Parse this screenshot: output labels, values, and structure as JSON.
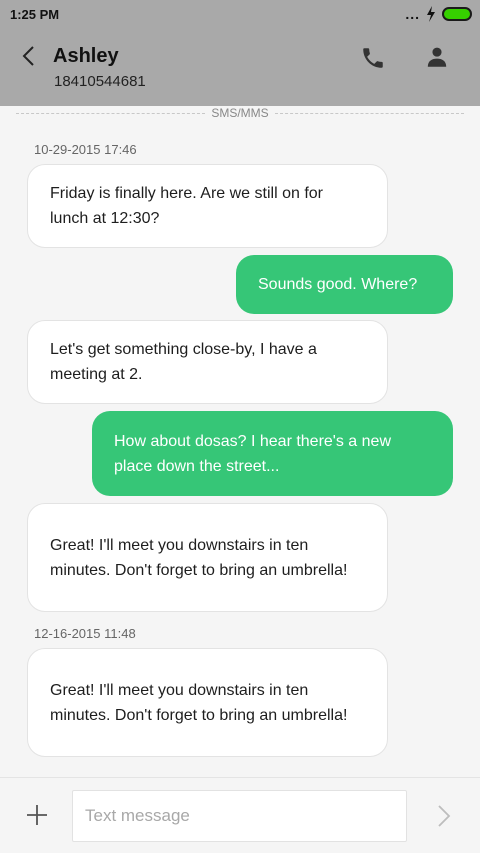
{
  "status_bar": {
    "time": "1:25 PM",
    "signal": "..."
  },
  "header": {
    "contact_name": "Ashley",
    "contact_number": "18410544681"
  },
  "channel_label": "SMS/MMS",
  "messages": [
    {
      "timestamp": "10-29-2015 17:46"
    },
    {
      "direction": "in",
      "text": "Friday is finally here. Are we still on for lunch at 12:30?"
    },
    {
      "direction": "out",
      "text": "Sounds good. Where?"
    },
    {
      "direction": "in",
      "text": "Let's get something close-by, I have a meeting at 2."
    },
    {
      "direction": "out",
      "text": "How about dosas? I hear there's a new place down the street..."
    },
    {
      "direction": "in",
      "text": "Great! I'll meet you downstairs in ten minutes. Don't forget to bring an umbrella!"
    },
    {
      "timestamp": "12-16-2015 11:48"
    },
    {
      "direction": "in",
      "text": "Great! I'll meet you downstairs in ten minutes. Don't forget to bring an umbrella!"
    }
  ],
  "composer": {
    "placeholder": "Text message"
  },
  "icons": {
    "back": "chevron-left-icon",
    "call": "phone-icon",
    "profile": "person-icon",
    "add": "plus-icon",
    "send": "chevron-right-icon"
  },
  "colors": {
    "outgoing_bubble": "#36c677",
    "header": "#a9a9a9",
    "battery": "#36d000"
  }
}
